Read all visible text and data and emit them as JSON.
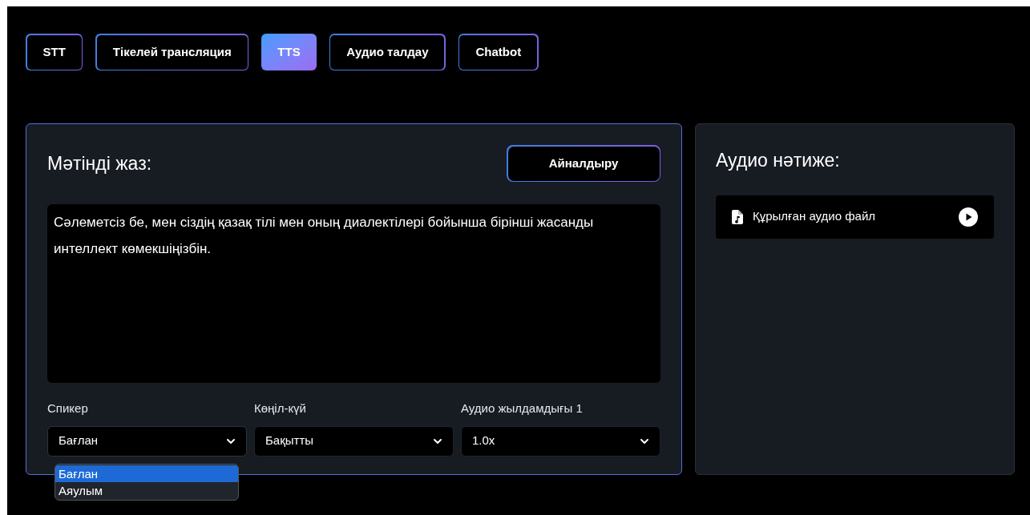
{
  "tabs": [
    {
      "label": "STT",
      "selected": false
    },
    {
      "label": "Тікелей трансляция",
      "selected": false
    },
    {
      "label": "TTS",
      "selected": true
    },
    {
      "label": "Аудио талдау",
      "selected": false
    },
    {
      "label": "Chatbot",
      "selected": false
    }
  ],
  "editor": {
    "title": "Мәтінді жаз:",
    "convert_button": "Айналдыру",
    "text": "Сәлеметсіз бе, мен сіздің қазақ тілі мен оның диалектілері бойынша бірінші жасанды интеллект көмекшіңізбін.",
    "selects": [
      {
        "label": "Спикер",
        "value": "Бағлан",
        "expanded": true,
        "options": [
          {
            "label": "Бағлан",
            "selected": true
          },
          {
            "label": "Аяулым",
            "selected": false
          }
        ]
      },
      {
        "label": "Көңіл-күй",
        "value": "Бақытты",
        "expanded": false
      },
      {
        "label": "Аудио жылдамдығы 1",
        "value": "1.0x",
        "expanded": false
      }
    ]
  },
  "result": {
    "title": "Аудио нәтиже:",
    "file_label": "Құрылған аудио файл"
  }
}
